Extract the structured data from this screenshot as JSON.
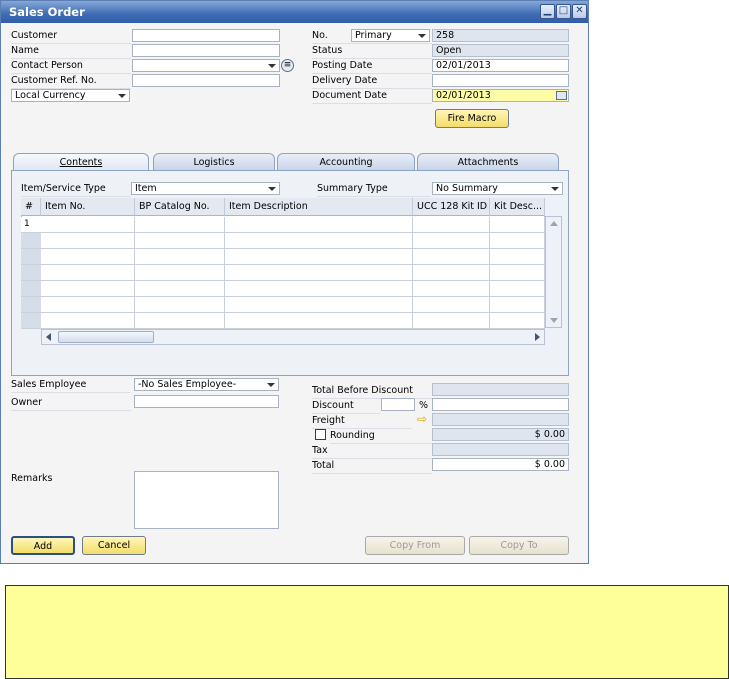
{
  "window": {
    "title": "Sales Order",
    "controls": {
      "minimize": "▁",
      "maximize": "□",
      "close": "✕"
    }
  },
  "header_left": {
    "customer_label": "Customer",
    "name_label": "Name",
    "contact_person_label": "Contact Person",
    "customer_ref_label": "Customer Ref. No.",
    "currency_value": "Local Currency"
  },
  "header_right": {
    "no_label": "No.",
    "series_value": "Primary",
    "no_value": "258",
    "status_label": "Status",
    "status_value": "Open",
    "posting_date_label": "Posting Date",
    "posting_date_value": "02/01/2013",
    "delivery_date_label": "Delivery Date",
    "document_date_label": "Document Date",
    "document_date_value": "02/01/2013",
    "fire_macro_label": "Fire Macro"
  },
  "tabs": [
    "Contents",
    "Logistics",
    "Accounting",
    "Attachments"
  ],
  "contents": {
    "item_type_label": "Item/Service Type",
    "item_type_value": "Item",
    "summary_type_label": "Summary Type",
    "summary_type_value": "No Summary",
    "columns": [
      "#",
      "Item No.",
      "BP Catalog No.",
      "Item Description",
      "UCC 128 Kit ID",
      "Kit Desc..."
    ],
    "first_row_number": "1"
  },
  "footer_left": {
    "sales_employee_label": "Sales Employee",
    "sales_employee_value": "-No Sales Employee-",
    "owner_label": "Owner",
    "remarks_label": "Remarks"
  },
  "footer_right": {
    "total_before_discount_label": "Total Before Discount",
    "discount_label": "Discount",
    "percent_sign": "%",
    "freight_label": "Freight",
    "rounding_label": "Rounding",
    "rounding_value": "$ 0.00",
    "tax_label": "Tax",
    "total_label": "Total",
    "total_value": "$ 0.00"
  },
  "buttons": {
    "add": "Add",
    "cancel": "Cancel",
    "copy_from": "Copy From",
    "copy_to": "Copy To"
  },
  "colors": {
    "title_bar": "#3e6cb4",
    "highlight_field": "#fffca8",
    "note_box": "#ffff99"
  }
}
